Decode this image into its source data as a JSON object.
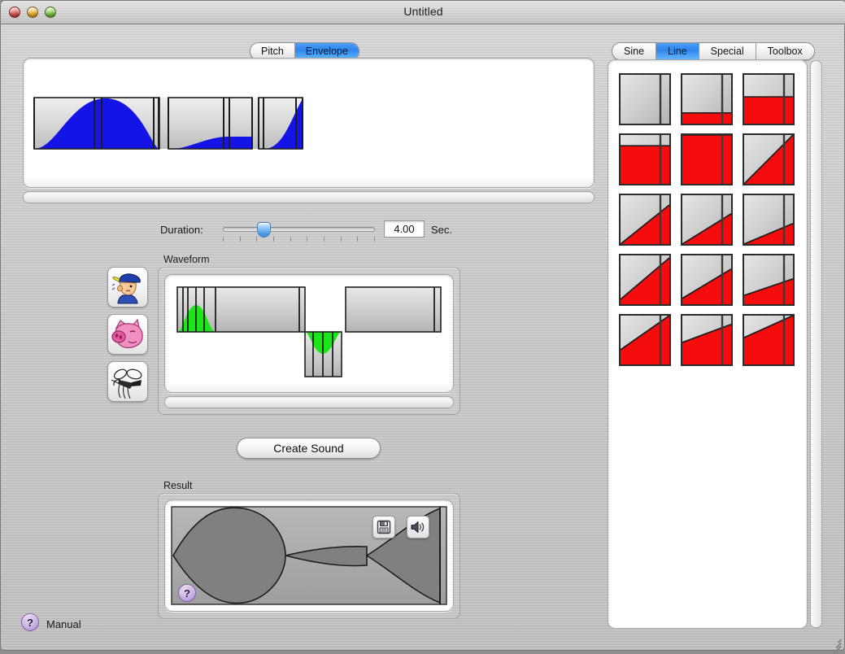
{
  "window": {
    "title": "Untitled",
    "traffic_lights": [
      "close-button",
      "minimize-button",
      "zoom-button"
    ]
  },
  "mode_tabs": {
    "items": [
      {
        "label": "Pitch",
        "active": false
      },
      {
        "label": "Envelope",
        "active": true
      }
    ]
  },
  "envelope": {
    "name": "envelope-editor",
    "fill_color": "#1414e6",
    "block_color": "#d2d2d2",
    "segments": [
      {
        "type": "rise-arc",
        "start": 0.0,
        "end": 0.22
      },
      {
        "type": "fall-arc",
        "start": 0.22,
        "end": 0.4
      },
      {
        "type": "flat-zero",
        "start": 0.4,
        "end": 0.44
      },
      {
        "type": "rise-arc-low",
        "start": 0.44,
        "end": 0.58
      },
      {
        "type": "plateau-low",
        "start": 0.58,
        "end": 0.72
      },
      {
        "type": "rise-arc",
        "start": 0.74,
        "end": 1.0
      }
    ]
  },
  "duration": {
    "label": "Duration:",
    "value": "4.00",
    "unit": "Sec.",
    "slider_position_pct": 27,
    "tick_count": 10
  },
  "presets": [
    {
      "name": "preset-whistling-boy",
      "icon": "whistling-boy-icon"
    },
    {
      "name": "preset-pig",
      "icon": "pig-icon"
    },
    {
      "name": "preset-mosquito",
      "icon": "mosquito-icon"
    }
  ],
  "waveform": {
    "label": "Waveform",
    "fill_color": "#1ae61a",
    "block_color": "#c8c8c8"
  },
  "create_sound": {
    "label": "Create Sound"
  },
  "result": {
    "label": "Result",
    "wave_color": "#808080",
    "buttons": [
      {
        "name": "save-button",
        "icon": "floppy-disk-icon"
      },
      {
        "name": "play-button",
        "icon": "speaker-icon"
      }
    ],
    "help_badge": "?"
  },
  "manual": {
    "badge": "?",
    "label": "Manual"
  },
  "palette_tabs": {
    "items": [
      {
        "label": "Sine",
        "active": false
      },
      {
        "label": "Line",
        "active": true
      },
      {
        "label": "Special",
        "active": false
      },
      {
        "label": "Toolbox",
        "active": false
      }
    ]
  },
  "palette": {
    "accent_color": "#f50d0d",
    "gray_color": "#cccccc",
    "tiles": [
      {
        "name": "tile-empty",
        "shape": "none"
      },
      {
        "name": "tile-fill-low",
        "shape": "fill",
        "level": 0.22
      },
      {
        "name": "tile-fill-half",
        "shape": "fill",
        "level": 0.55
      },
      {
        "name": "tile-fill-high",
        "shape": "fill",
        "level": 0.78
      },
      {
        "name": "tile-fill-full",
        "shape": "fill",
        "level": 1.0
      },
      {
        "name": "tile-ramp-45",
        "shape": "ramp",
        "left": 0.0,
        "right": 1.0
      },
      {
        "name": "tile-ramp-steep",
        "shape": "ramp",
        "left": 0.0,
        "right": 0.8
      },
      {
        "name": "tile-ramp-mid",
        "shape": "ramp",
        "left": 0.0,
        "right": 0.62
      },
      {
        "name": "tile-ramp-shallow",
        "shape": "ramp",
        "left": 0.0,
        "right": 0.42
      },
      {
        "name": "tile-ramp-low-1",
        "shape": "ramp",
        "left": 0.1,
        "right": 0.95
      },
      {
        "name": "tile-ramp-low-2",
        "shape": "ramp",
        "left": 0.12,
        "right": 0.72
      },
      {
        "name": "tile-ramp-low-3",
        "shape": "ramp",
        "left": 0.18,
        "right": 0.52
      },
      {
        "name": "tile-ramp-high-1",
        "shape": "ramp",
        "left": 0.3,
        "right": 1.0
      },
      {
        "name": "tile-ramp-high-2",
        "shape": "ramp",
        "left": 0.45,
        "right": 0.82
      },
      {
        "name": "tile-ramp-high-3",
        "shape": "ramp",
        "left": 0.55,
        "right": 1.0
      }
    ]
  }
}
